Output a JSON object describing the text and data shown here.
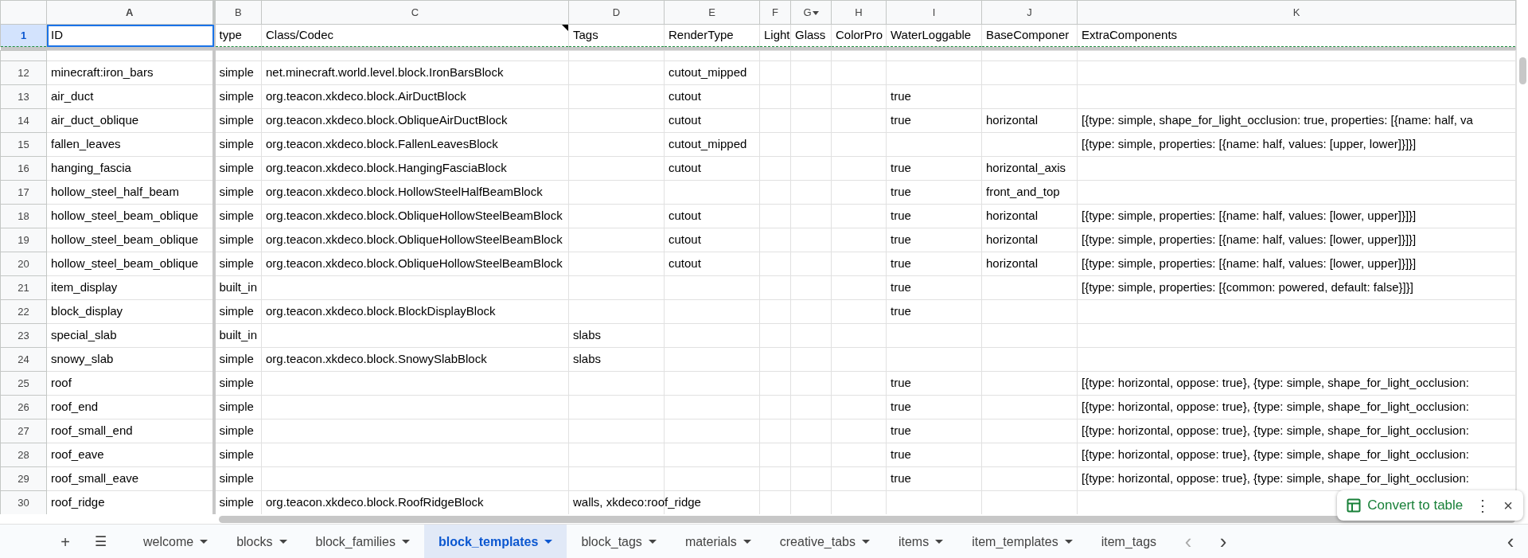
{
  "columns": [
    {
      "letter": "A",
      "selected": true
    },
    {
      "letter": "B",
      "selected": false
    },
    {
      "letter": "C",
      "selected": false
    },
    {
      "letter": "D",
      "selected": false
    },
    {
      "letter": "E",
      "selected": false
    },
    {
      "letter": "F",
      "selected": false
    },
    {
      "letter": "G",
      "selected": false,
      "filter": true
    },
    {
      "letter": "H",
      "selected": false
    },
    {
      "letter": "I",
      "selected": false
    },
    {
      "letter": "J",
      "selected": false
    },
    {
      "letter": "K",
      "selected": false
    }
  ],
  "header_row": {
    "number": "1",
    "selected": true,
    "cells": [
      {
        "text": "ID",
        "active": true,
        "note": false
      },
      {
        "text": "type",
        "active": false,
        "note": false
      },
      {
        "text": "Class/Codec",
        "active": false,
        "note": true
      },
      {
        "text": "Tags",
        "active": false,
        "note": false
      },
      {
        "text": "RenderType",
        "active": false,
        "note": false
      },
      {
        "text": "Light",
        "active": false,
        "note": false
      },
      {
        "text": "Glass",
        "active": false,
        "note": false
      },
      {
        "text": "ColorPro",
        "active": false,
        "note": false
      },
      {
        "text": "WaterLoggable",
        "active": false,
        "note": false
      },
      {
        "text": "BaseComponer",
        "active": false,
        "note": false
      },
      {
        "text": "ExtraComponents",
        "active": false,
        "note": false
      }
    ]
  },
  "rows": [
    {
      "number": "12",
      "cells": {
        "A": "minecraft:iron_bars",
        "B": "simple",
        "C": "net.minecraft.world.level.block.IronBarsBlock",
        "E": "cutout_mipped"
      }
    },
    {
      "number": "13",
      "cells": {
        "A": "air_duct",
        "B": "simple",
        "C": "org.teacon.xkdeco.block.AirDuctBlock",
        "E": "cutout",
        "I": "true"
      }
    },
    {
      "number": "14",
      "cells": {
        "A": "air_duct_oblique",
        "B": "simple",
        "C": "org.teacon.xkdeco.block.ObliqueAirDuctBlock",
        "E": "cutout",
        "I": "true",
        "J": "horizontal",
        "K": "[{type: simple, shape_for_light_occlusion: true, properties: [{name: half, va"
      }
    },
    {
      "number": "15",
      "cells": {
        "A": "fallen_leaves",
        "B": "simple",
        "C": "org.teacon.xkdeco.block.FallenLeavesBlock",
        "E": "cutout_mipped",
        "K": "[{type: simple, properties: [{name: half, values: [upper, lower]}]}]"
      }
    },
    {
      "number": "16",
      "cells": {
        "A": "hanging_fascia",
        "B": "simple",
        "C": "org.teacon.xkdeco.block.HangingFasciaBlock",
        "E": "cutout",
        "I": "true",
        "J": "horizontal_axis"
      }
    },
    {
      "number": "17",
      "cells": {
        "A": "hollow_steel_half_beam",
        "B": "simple",
        "C": "org.teacon.xkdeco.block.HollowSteelHalfBeamBlock",
        "I": "true",
        "J": "front_and_top"
      }
    },
    {
      "number": "18",
      "cells": {
        "A": "hollow_steel_beam_oblique",
        "B": "simple",
        "C": "org.teacon.xkdeco.block.ObliqueHollowSteelBeamBlock",
        "E": "cutout",
        "I": "true",
        "J": "horizontal",
        "K": "[{type: simple, properties: [{name: half, values: [lower, upper]}]}]"
      }
    },
    {
      "number": "19",
      "cells": {
        "A": "hollow_steel_beam_oblique",
        "B": "simple",
        "C": "org.teacon.xkdeco.block.ObliqueHollowSteelBeamBlock",
        "E": "cutout",
        "I": "true",
        "J": "horizontal",
        "K": "[{type: simple, properties: [{name: half, values: [lower, upper]}]}]"
      }
    },
    {
      "number": "20",
      "cells": {
        "A": "hollow_steel_beam_oblique",
        "B": "simple",
        "C": "org.teacon.xkdeco.block.ObliqueHollowSteelBeamBlock",
        "E": "cutout",
        "I": "true",
        "J": "horizontal",
        "K": "[{type: simple, properties: [{name: half, values: [lower, upper]}]}]"
      }
    },
    {
      "number": "21",
      "cells": {
        "A": "item_display",
        "B": "built_in",
        "I": "true",
        "K": "[{type: simple, properties: [{common: powered, default: false}]}]"
      }
    },
    {
      "number": "22",
      "cells": {
        "A": "block_display",
        "B": "simple",
        "C": "org.teacon.xkdeco.block.BlockDisplayBlock",
        "I": "true"
      }
    },
    {
      "number": "23",
      "cells": {
        "A": "special_slab",
        "B": "built_in",
        "D": "slabs"
      }
    },
    {
      "number": "24",
      "cells": {
        "A": "snowy_slab",
        "B": "simple",
        "C": "org.teacon.xkdeco.block.SnowySlabBlock",
        "D": "slabs"
      }
    },
    {
      "number": "25",
      "cells": {
        "A": "roof",
        "B": "simple",
        "I": "true",
        "K": "[{type: horizontal, oppose: true}, {type: simple, shape_for_light_occlusion:"
      }
    },
    {
      "number": "26",
      "cells": {
        "A": "roof_end",
        "B": "simple",
        "I": "true",
        "K": "[{type: horizontal, oppose: true}, {type: simple, shape_for_light_occlusion:"
      }
    },
    {
      "number": "27",
      "cells": {
        "A": "roof_small_end",
        "B": "simple",
        "I": "true",
        "K": "[{type: horizontal, oppose: true}, {type: simple, shape_for_light_occlusion:"
      }
    },
    {
      "number": "28",
      "cells": {
        "A": "roof_eave",
        "B": "simple",
        "I": "true",
        "K": "[{type: horizontal, oppose: true}, {type: simple, shape_for_light_occlusion:"
      }
    },
    {
      "number": "29",
      "cells": {
        "A": "roof_small_eave",
        "B": "simple",
        "I": "true",
        "K": "[{type: horizontal, oppose: true}, {type: simple, shape_for_light_occlusion:"
      }
    },
    {
      "number": "30",
      "cells": {
        "A": "roof_ridge",
        "B": "simple",
        "C": "org.teacon.xkdeco.block.RoofRidgeBlock",
        "D": "walls, xkdeco:roof_ridge"
      }
    }
  ],
  "popup": {
    "label": "Convert to table",
    "more": "⋮",
    "close": "×"
  },
  "sheet_tabs": {
    "add": "+",
    "menu": "☰",
    "tabs": [
      {
        "label": "welcome",
        "selected": false,
        "caret": true
      },
      {
        "label": "blocks",
        "selected": false,
        "caret": true
      },
      {
        "label": "block_families",
        "selected": false,
        "caret": true
      },
      {
        "label": "block_templates",
        "selected": true,
        "caret": true
      },
      {
        "label": "block_tags",
        "selected": false,
        "caret": true
      },
      {
        "label": "materials",
        "selected": false,
        "caret": true
      },
      {
        "label": "creative_tabs",
        "selected": false,
        "caret": true
      },
      {
        "label": "items",
        "selected": false,
        "caret": true
      },
      {
        "label": "item_templates",
        "selected": false,
        "caret": true
      },
      {
        "label": "item_tags",
        "selected": false,
        "caret": false
      }
    ],
    "prev": "‹",
    "next": "›",
    "collapse": "‹"
  }
}
